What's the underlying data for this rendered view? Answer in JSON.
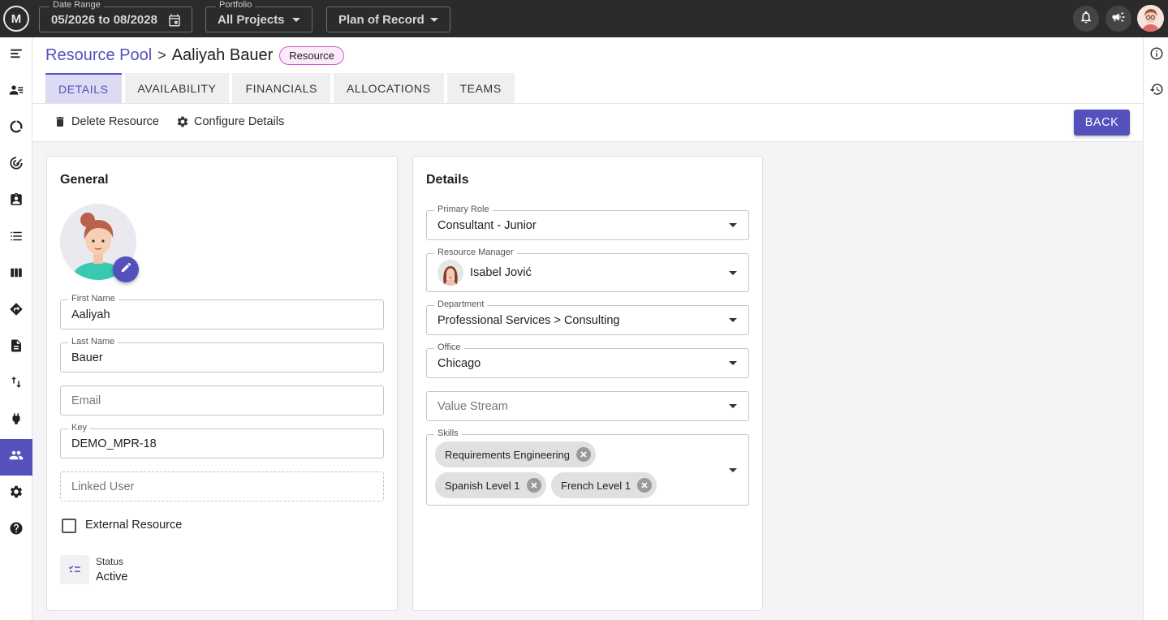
{
  "topbar": {
    "logo_text": "M",
    "date_range": {
      "label": "Date Range",
      "value": "05/2026 to 08/2028"
    },
    "portfolio": {
      "label": "Portfolio",
      "value": "All Projects"
    },
    "plan": {
      "value": "Plan of Record"
    }
  },
  "sidebar": {
    "items": [
      {
        "icon": "menu-icon"
      },
      {
        "icon": "people-list-icon"
      },
      {
        "icon": "donut-chart-icon"
      },
      {
        "icon": "target-icon"
      },
      {
        "icon": "contact-badge-icon"
      },
      {
        "icon": "list-icon"
      },
      {
        "icon": "columns-icon"
      },
      {
        "icon": "roadmap-icon"
      },
      {
        "icon": "document-icon"
      },
      {
        "icon": "swap-icon"
      },
      {
        "icon": "plug-icon"
      },
      {
        "icon": "group-icon",
        "active": true
      },
      {
        "icon": "settings-icon"
      },
      {
        "icon": "help-icon"
      }
    ]
  },
  "header": {
    "breadcrumb_parent": "Resource Pool",
    "breadcrumb_sep": ">",
    "resource_name": "Aaliyah Bauer",
    "badge": "Resource",
    "tabs": [
      "DETAILS",
      "AVAILABILITY",
      "FINANCIALS",
      "ALLOCATIONS",
      "TEAMS"
    ],
    "actions": {
      "delete": "Delete Resource",
      "configure": "Configure Details"
    },
    "back": "BACK"
  },
  "general": {
    "title": "General",
    "first_name": {
      "label": "First Name",
      "value": "Aaliyah"
    },
    "last_name": {
      "label": "Last Name",
      "value": "Bauer"
    },
    "email": {
      "placeholder": "Email"
    },
    "key": {
      "label": "Key",
      "value": "DEMO_MPR-18"
    },
    "linked_user": {
      "placeholder": "Linked User"
    },
    "external_resource": {
      "label": "External Resource",
      "checked": false
    },
    "status": {
      "label": "Status",
      "value": "Active"
    }
  },
  "details": {
    "title": "Details",
    "primary_role": {
      "label": "Primary Role",
      "value": "Consultant - Junior"
    },
    "resource_manager": {
      "label": "Resource Manager",
      "value": "Isabel Jović"
    },
    "department": {
      "label": "Department",
      "value": "Professional Services > Consulting"
    },
    "office": {
      "label": "Office",
      "value": "Chicago"
    },
    "value_stream": {
      "placeholder": "Value Stream"
    },
    "skills": {
      "label": "Skills",
      "items": [
        "Requirements Engineering",
        "Spanish Level 1",
        "French Level 1"
      ]
    }
  },
  "colors": {
    "accent": "#5451bd",
    "topbar": "#2b2b2b",
    "badge_border": "#d45ad0"
  }
}
